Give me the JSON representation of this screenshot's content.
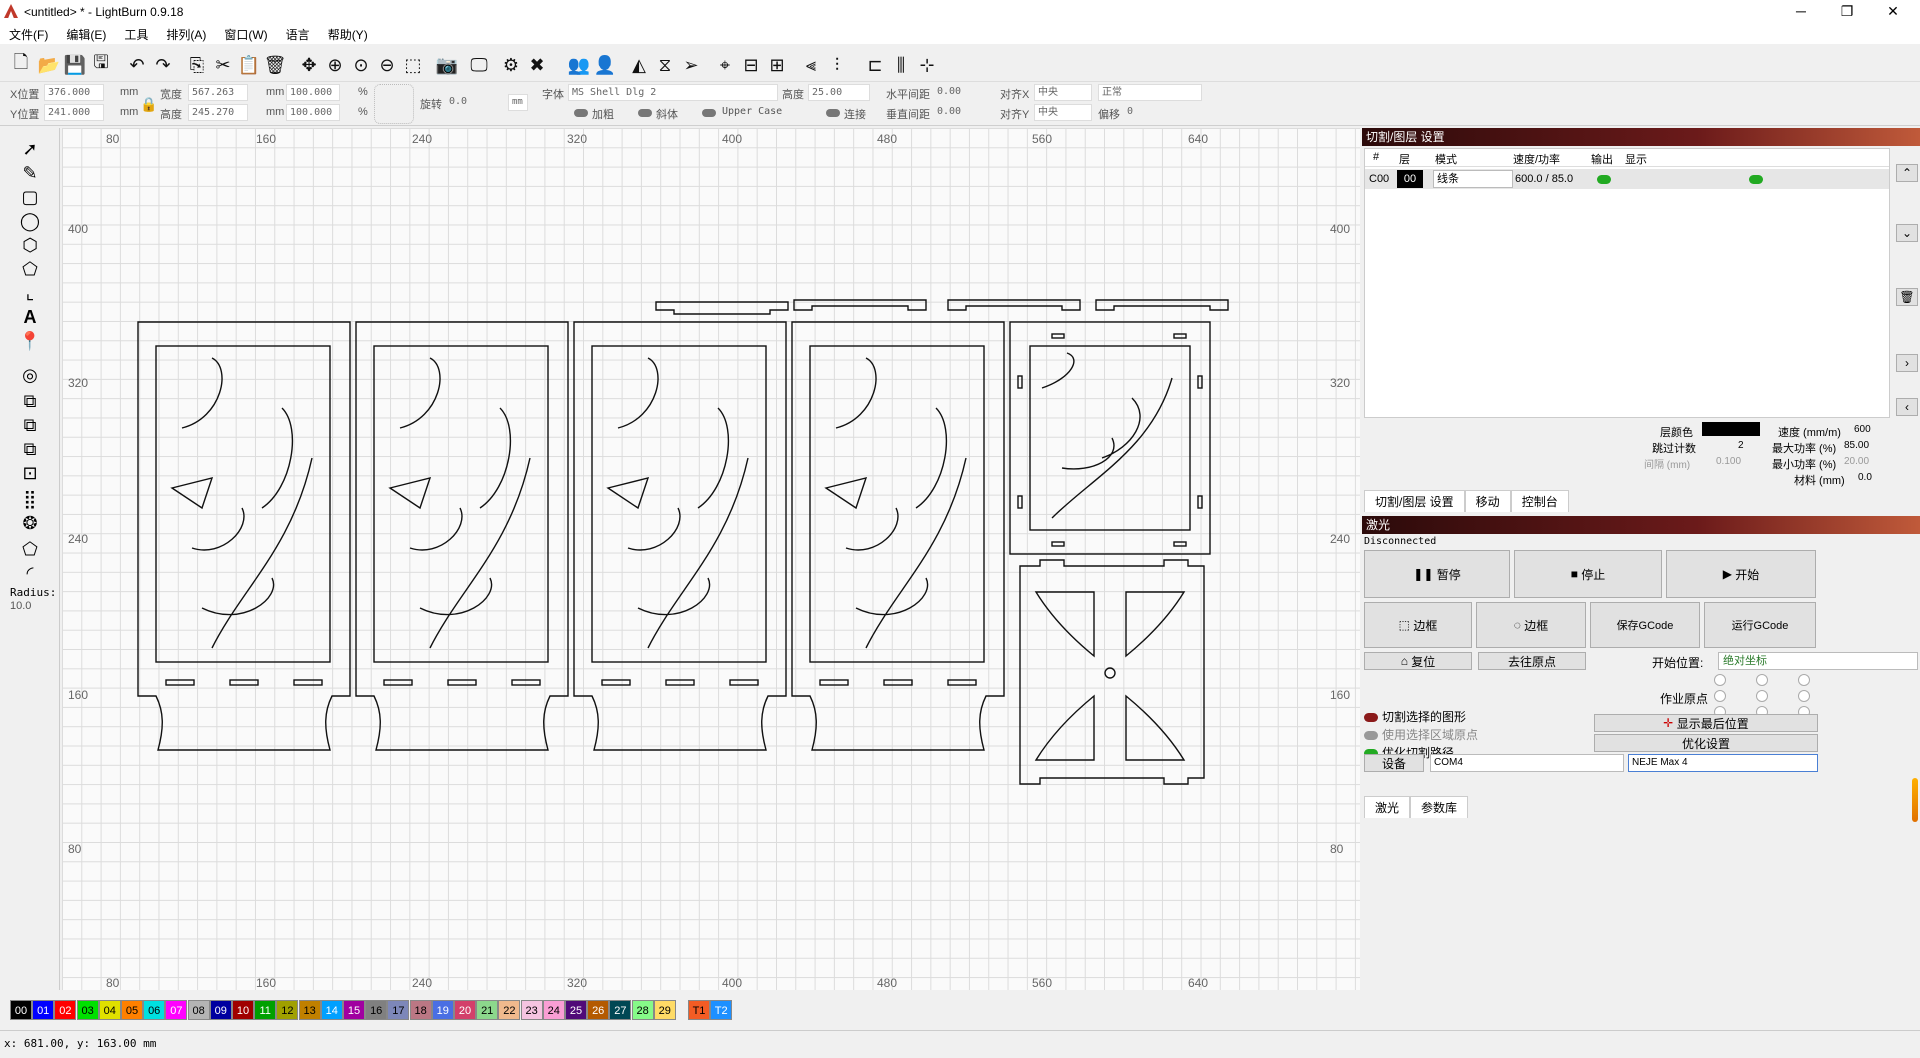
{
  "window": {
    "title": "<untitled> * - LightBurn 0.9.18",
    "minimize": "─",
    "maximize": "❐",
    "close": "✕"
  },
  "menu": [
    "文件(F)",
    "编辑(E)",
    "工具",
    "排列(A)",
    "窗口(W)",
    "语言",
    "帮助(Y)"
  ],
  "props": {
    "x_label": "X位置",
    "x_value": "376.000",
    "y_label": "Y位置",
    "y_value": "241.000",
    "w_label": "宽度",
    "w_value": "567.263",
    "h_label": "高度",
    "h_value": "245.270",
    "unit": "mm",
    "sx": "100.000",
    "sy": "100.000",
    "pct": "%",
    "rot_label": "旋转",
    "rot_value": "0.0",
    "mm_btn": "mm",
    "font_label": "字体",
    "font_value": "MS Shell Dlg 2",
    "height_label": "高度",
    "height_value": "25.00",
    "hspace_label": "水平间距",
    "hspace_value": "0.00",
    "alignx_label": "对齐X",
    "alignx_value": "中央",
    "mode_value": "正常",
    "bold_label": "加粗",
    "italic_label": "斜体",
    "upper_label": "Upper Case",
    "weld_label": "连接",
    "vspace_label": "垂直间距",
    "vspace_value": "0.00",
    "aligny_label": "对齐Y",
    "aligny_value": "中央",
    "offset_label": "偏移",
    "offset_value": "0"
  },
  "left": {
    "radius_label": "Radius:",
    "radius_value": "10.0"
  },
  "rulers": {
    "top": [
      "80",
      "160",
      "240",
      "320",
      "400",
      "480",
      "560",
      "640"
    ],
    "left": [
      "400",
      "320",
      "240",
      "160",
      "80"
    ],
    "right": [
      "400",
      "320",
      "240",
      "160",
      "80"
    ]
  },
  "cutpanel": {
    "title": "切割/图层 设置",
    "headers": [
      "#",
      "层",
      "模式",
      "速度/功率",
      "输出",
      "显示"
    ],
    "row": {
      "id": "C00",
      "layer": "00",
      "mode": "线条",
      "speed_power": "600.0 / 85.0"
    },
    "layer_color_label": "层颜色",
    "speed_label": "速度 (mm/m)",
    "speed_value": "600",
    "pass_label": "跳过计数",
    "pass_value": "2",
    "maxp_label": "最大功率 (%)",
    "maxp_value": "85.00",
    "interval_label": "间隔 (mm)",
    "interval_value": "0.100",
    "minp_label": "最小功率 (%)",
    "minp_value": "20.00",
    "mat_label": "材料 (mm)",
    "mat_value": "0.0",
    "tabs": [
      "切割/图层 设置",
      "移动",
      "控制台"
    ]
  },
  "laser": {
    "title": "激光",
    "status": "Disconnected",
    "pause": "暂停",
    "stop": "停止",
    "start": "开始",
    "frame1": "边框",
    "frame2": "边框",
    "save_gcode": "保存GCode",
    "run_gcode": "运行GCode",
    "home": "复位",
    "goto_origin": "去往原点",
    "start_from_label": "开始位置:",
    "start_from_value": "绝对坐标",
    "job_origin_label": "作业原点",
    "cut_selected": "切割选择的图形",
    "use_sel_origin": "使用选择区域原点",
    "optimize": "优化切割路径",
    "show_last": "显示最后位置",
    "opt_settings": "优化设置",
    "device_btn": "设备",
    "port": "COM4",
    "device": "NEJE Max 4",
    "tabs": [
      "激光",
      "参数库"
    ]
  },
  "palette": [
    {
      "l": "00",
      "c": "#000000",
      "t": "#ffffff"
    },
    {
      "l": "01",
      "c": "#0000ff",
      "t": "#ffffff"
    },
    {
      "l": "02",
      "c": "#ff0000",
      "t": "#ffffff"
    },
    {
      "l": "03",
      "c": "#00e000",
      "t": "#000000"
    },
    {
      "l": "04",
      "c": "#e0e000",
      "t": "#000000"
    },
    {
      "l": "05",
      "c": "#ff8000",
      "t": "#000000"
    },
    {
      "l": "06",
      "c": "#00e0e0",
      "t": "#000000"
    },
    {
      "l": "07",
      "c": "#ff00ff",
      "t": "#ffffff"
    },
    {
      "l": "08",
      "c": "#b4b4b4",
      "t": "#000000"
    },
    {
      "l": "09",
      "c": "#0000a0",
      "t": "#ffffff"
    },
    {
      "l": "10",
      "c": "#a00000",
      "t": "#ffffff"
    },
    {
      "l": "11",
      "c": "#00a000",
      "t": "#ffffff"
    },
    {
      "l": "12",
      "c": "#a0a000",
      "t": "#000000"
    },
    {
      "l": "13",
      "c": "#c08000",
      "t": "#000000"
    },
    {
      "l": "14",
      "c": "#00a0ff",
      "t": "#ffffff"
    },
    {
      "l": "15",
      "c": "#a000a0",
      "t": "#ffffff"
    },
    {
      "l": "16",
      "c": "#808080",
      "t": "#000000"
    },
    {
      "l": "17",
      "c": "#7d87b9",
      "t": "#000000"
    },
    {
      "l": "18",
      "c": "#bb7784",
      "t": "#000000"
    },
    {
      "l": "19",
      "c": "#4a6fe3",
      "t": "#ffffff"
    },
    {
      "l": "20",
      "c": "#d33f6a",
      "t": "#ffffff"
    },
    {
      "l": "21",
      "c": "#8cd78c",
      "t": "#000000"
    },
    {
      "l": "22",
      "c": "#f0b98d",
      "t": "#000000"
    },
    {
      "l": "23",
      "c": "#f6c4e1",
      "t": "#000000"
    },
    {
      "l": "24",
      "c": "#fa9ed4",
      "t": "#000000"
    },
    {
      "l": "25",
      "c": "#500a78",
      "t": "#ffffff"
    },
    {
      "l": "26",
      "c": "#b45a00",
      "t": "#ffffff"
    },
    {
      "l": "27",
      "c": "#004754",
      "t": "#ffffff"
    },
    {
      "l": "28",
      "c": "#86fa88",
      "t": "#000000"
    },
    {
      "l": "29",
      "c": "#ffdb66",
      "t": "#000000"
    },
    {
      "l": "T1",
      "c": "#f35c24",
      "t": "#000000"
    },
    {
      "l": "T2",
      "c": "#1e90ff",
      "t": "#ffffff"
    }
  ],
  "status": {
    "coords": "x: 681.00, y: 163.00 mm"
  }
}
